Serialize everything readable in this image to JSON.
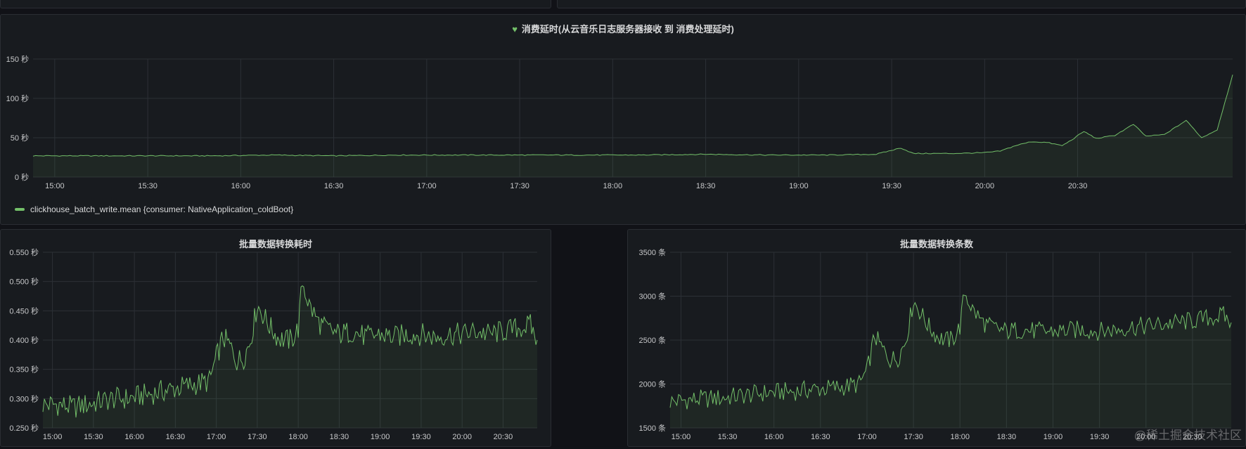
{
  "colors": {
    "series": "#73bf69",
    "grid": "#2c3036",
    "text": "#c7c8ca",
    "panel": "#181b1f"
  },
  "panels": {
    "top": {
      "title": "消费延时(从云音乐日志服务器接收 到 消费处理延时)",
      "icon": "heart-icon",
      "legend": "clickhouse_batch_write.mean {consumer: NativeApplication_coldBoot}"
    },
    "left": {
      "title": "批量数据转换耗时"
    },
    "right": {
      "title": "批量数据转换条数"
    }
  },
  "watermark": "@稀土掘金技术社区",
  "chart_data": [
    {
      "type": "area",
      "title": "消费延时(从云音乐日志服务器接收 到 消费处理延时)",
      "x_ticks": [
        "15:00",
        "15:30",
        "16:00",
        "16:30",
        "17:00",
        "17:30",
        "18:00",
        "18:30",
        "19:00",
        "19:30",
        "20:00",
        "20:30"
      ],
      "x_range": [
        "14:53",
        "21:20"
      ],
      "y_ticks": [
        "0 秒",
        "50 秒",
        "100 秒",
        "150 秒"
      ],
      "ylim": [
        0,
        150
      ],
      "series": [
        {
          "name": "clickhouse_batch_write.mean {consumer: NativeApplication_coldBoot}",
          "points": [
            [
              "14:53",
              27
            ],
            [
              "15:10",
              27
            ],
            [
              "15:30",
              27
            ],
            [
              "15:50",
              27
            ],
            [
              "16:10",
              28
            ],
            [
              "16:30",
              27
            ],
            [
              "16:50",
              28
            ],
            [
              "17:10",
              28
            ],
            [
              "17:30",
              28
            ],
            [
              "17:50",
              28
            ],
            [
              "18:10",
              28
            ],
            [
              "18:30",
              29
            ],
            [
              "18:50",
              28
            ],
            [
              "19:10",
              28
            ],
            [
              "19:25",
              29
            ],
            [
              "19:33",
              37
            ],
            [
              "19:37",
              30
            ],
            [
              "19:50",
              30
            ],
            [
              "20:00",
              31
            ],
            [
              "20:05",
              33
            ],
            [
              "20:10",
              40
            ],
            [
              "20:15",
              45
            ],
            [
              "20:20",
              44
            ],
            [
              "20:25",
              40
            ],
            [
              "20:28",
              47
            ],
            [
              "20:32",
              58
            ],
            [
              "20:36",
              49
            ],
            [
              "20:42",
              53
            ],
            [
              "20:48",
              67
            ],
            [
              "20:52",
              52
            ],
            [
              "20:58",
              54
            ],
            [
              "21:05",
              72
            ],
            [
              "21:10",
              50
            ],
            [
              "21:15",
              60
            ],
            [
              "21:20",
              130
            ]
          ]
        }
      ],
      "legend": "bottom-left",
      "grid": true
    },
    {
      "type": "area",
      "title": "批量数据转换耗时",
      "x_ticks": [
        "15:00",
        "15:30",
        "16:00",
        "16:30",
        "17:00",
        "17:30",
        "18:00",
        "18:30",
        "19:00",
        "19:30",
        "20:00",
        "20:30"
      ],
      "x_range": [
        "14:53",
        "20:55"
      ],
      "y_ticks": [
        "0.250 秒",
        "0.300 秒",
        "0.350 秒",
        "0.400 秒",
        "0.450 秒",
        "0.500 秒",
        "0.550 秒"
      ],
      "ylim": [
        0.25,
        0.55
      ],
      "series": [
        {
          "points": [
            [
              "14:53",
              0.29
            ],
            [
              "15:05",
              0.29
            ],
            [
              "15:15",
              0.285
            ],
            [
              "15:25",
              0.29
            ],
            [
              "15:35",
              0.295
            ],
            [
              "15:45",
              0.3
            ],
            [
              "15:55",
              0.3
            ],
            [
              "16:05",
              0.305
            ],
            [
              "16:15",
              0.31
            ],
            [
              "16:25",
              0.315
            ],
            [
              "16:35",
              0.32
            ],
            [
              "16:45",
              0.325
            ],
            [
              "16:55",
              0.33
            ],
            [
              "17:00",
              0.37
            ],
            [
              "17:05",
              0.405
            ],
            [
              "17:10",
              0.39
            ],
            [
              "17:15",
              0.365
            ],
            [
              "17:20",
              0.37
            ],
            [
              "17:25",
              0.4
            ],
            [
              "17:30",
              0.46
            ],
            [
              "17:35",
              0.44
            ],
            [
              "17:40",
              0.42
            ],
            [
              "17:45",
              0.405
            ],
            [
              "17:50",
              0.4
            ],
            [
              "17:55",
              0.4
            ],
            [
              "18:00",
              0.42
            ],
            [
              "18:03",
              0.5
            ],
            [
              "18:08",
              0.46
            ],
            [
              "18:15",
              0.43
            ],
            [
              "18:20",
              0.42
            ],
            [
              "18:30",
              0.41
            ],
            [
              "18:40",
              0.415
            ],
            [
              "18:50",
              0.405
            ],
            [
              "19:00",
              0.41
            ],
            [
              "19:10",
              0.405
            ],
            [
              "19:20",
              0.41
            ],
            [
              "19:30",
              0.41
            ],
            [
              "19:40",
              0.405
            ],
            [
              "19:50",
              0.41
            ],
            [
              "20:00",
              0.41
            ],
            [
              "20:10",
              0.415
            ],
            [
              "20:20",
              0.41
            ],
            [
              "20:30",
              0.415
            ],
            [
              "20:40",
              0.42
            ],
            [
              "20:50",
              0.425
            ],
            [
              "20:55",
              0.4
            ]
          ]
        }
      ],
      "grid": true
    },
    {
      "type": "area",
      "title": "批量数据转换条数",
      "x_ticks": [
        "15:00",
        "15:30",
        "16:00",
        "16:30",
        "17:00",
        "17:30",
        "18:00",
        "18:30",
        "19:00",
        "19:30",
        "20:00",
        "20:30"
      ],
      "x_range": [
        "14:53",
        "20:55"
      ],
      "y_ticks": [
        "1500 条",
        "2000 条",
        "2500 条",
        "3000 条",
        "3500 条"
      ],
      "ylim": [
        1500,
        3500
      ],
      "series": [
        {
          "points": [
            [
              "14:53",
              1800
            ],
            [
              "15:05",
              1820
            ],
            [
              "15:15",
              1830
            ],
            [
              "15:25",
              1840
            ],
            [
              "15:35",
              1860
            ],
            [
              "15:45",
              1880
            ],
            [
              "15:55",
              1900
            ],
            [
              "16:05",
              1910
            ],
            [
              "16:15",
              1920
            ],
            [
              "16:25",
              1940
            ],
            [
              "16:35",
              1950
            ],
            [
              "16:45",
              1970
            ],
            [
              "16:55",
              2000
            ],
            [
              "17:00",
              2150
            ],
            [
              "17:05",
              2550
            ],
            [
              "17:10",
              2400
            ],
            [
              "17:15",
              2280
            ],
            [
              "17:20",
              2300
            ],
            [
              "17:25",
              2500
            ],
            [
              "17:30",
              2950
            ],
            [
              "17:35",
              2800
            ],
            [
              "17:40",
              2650
            ],
            [
              "17:45",
              2550
            ],
            [
              "17:50",
              2500
            ],
            [
              "17:55",
              2500
            ],
            [
              "18:00",
              2650
            ],
            [
              "18:03",
              3050
            ],
            [
              "18:08",
              2850
            ],
            [
              "18:15",
              2700
            ],
            [
              "18:20",
              2650
            ],
            [
              "18:30",
              2600
            ],
            [
              "18:40",
              2620
            ],
            [
              "18:50",
              2600
            ],
            [
              "19:00",
              2600
            ],
            [
              "19:10",
              2610
            ],
            [
              "19:20",
              2620
            ],
            [
              "19:30",
              2600
            ],
            [
              "19:40",
              2620
            ],
            [
              "19:50",
              2650
            ],
            [
              "20:00",
              2660
            ],
            [
              "20:10",
              2680
            ],
            [
              "20:20",
              2700
            ],
            [
              "20:30",
              2720
            ],
            [
              "20:40",
              2750
            ],
            [
              "20:50",
              2780
            ],
            [
              "20:55",
              2700
            ]
          ]
        }
      ],
      "grid": true
    }
  ]
}
